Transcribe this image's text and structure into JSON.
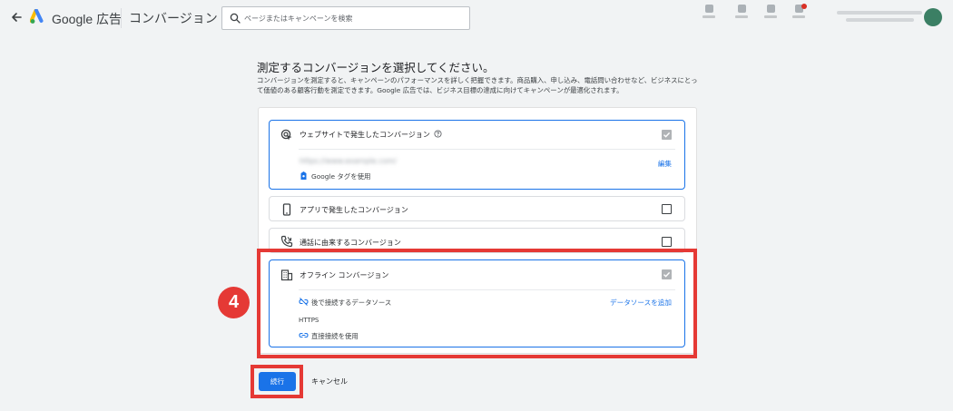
{
  "header": {
    "brand": "Google 広告",
    "page_name": "コンバージョン",
    "search_placeholder": "ページまたはキャンペーンを検索"
  },
  "main": {
    "title": "測定するコンバージョンを選択してください。",
    "description": "コンバージョンを測定すると、キャンペーンのパフォーマンスを詳しく把握できます。商品購入、申し込み、電話問い合わせなど、ビジネスにとって価値のある顧客行動を測定できます。Google 広告では、ビジネス目標の達成に向けてキャンペーンが最適化されます。"
  },
  "options": {
    "website": {
      "label": "ウェブサイトで発生したコンバージョン",
      "url": "https://www.example.com/",
      "tag_label": "Google タグを使用",
      "edit_label": "編集",
      "checked": true
    },
    "app": {
      "label": "アプリで発生したコンバージョン",
      "checked": false
    },
    "calls": {
      "label": "通話に由来するコンバージョン",
      "checked": false
    },
    "offline": {
      "label": "オフライン コンバージョン",
      "checked": true,
      "source_label": "後で接続するデータソース",
      "add_source_label": "データソースを追加",
      "https_label": "HTTPS",
      "direct_label": "直接接続を使用"
    }
  },
  "annotation": {
    "step_number": "4",
    "highlight_color": "#e53935"
  },
  "actions": {
    "continue_label": "続行",
    "cancel_label": "キャンセル"
  },
  "colors": {
    "accent": "#1a73e8",
    "background": "#f1f3f4"
  }
}
